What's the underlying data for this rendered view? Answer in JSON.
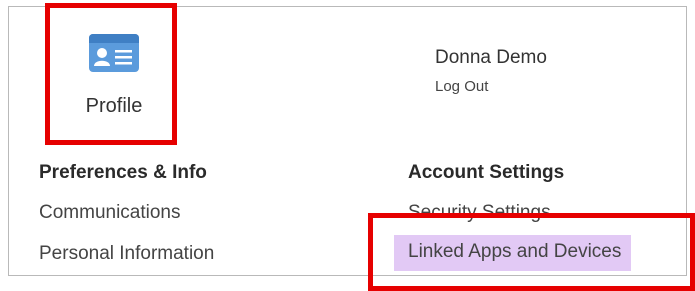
{
  "profile": {
    "label": "Profile",
    "icon": "id-card-icon",
    "icon_color": "#4a90d9"
  },
  "user": {
    "name": "Donna Demo",
    "logout_label": "Log Out"
  },
  "preferences": {
    "heading": "Preferences & Info",
    "items": [
      {
        "label": "Communications"
      },
      {
        "label": "Personal Information"
      }
    ]
  },
  "account": {
    "heading": "Account Settings",
    "items": [
      {
        "label": "Security Settings"
      },
      {
        "label": "Linked Apps and Devices",
        "highlighted": true
      }
    ]
  },
  "colors": {
    "highlight": "#e2c9f5",
    "annotation": "#e60000",
    "border": "#b9b9b9"
  }
}
